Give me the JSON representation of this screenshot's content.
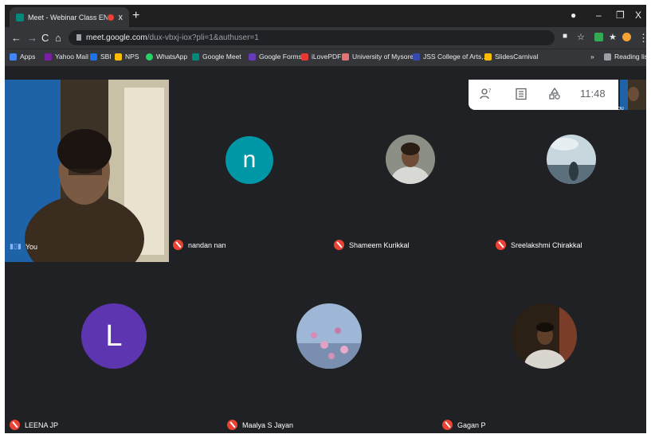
{
  "browser": {
    "tab_title": "Meet - Webinar Class END (",
    "tab_close": "x",
    "new_tab": "+",
    "url_domain": "meet.google.com",
    "url_rest": "/dux-vbxj-iox?pli=1&authuser=1",
    "window_controls": {
      "minimize": "–",
      "restore": "❐",
      "close": "X"
    }
  },
  "bookmarks": [
    {
      "label": "Apps",
      "color": "#4285f4"
    },
    {
      "label": "Yahoo Mail",
      "color": "#7b1fa2"
    },
    {
      "label": "SBI",
      "color": "#1a73e8"
    },
    {
      "label": "NPS",
      "color": "#fbbc04"
    },
    {
      "label": "WhatsApp",
      "color": "#25d366"
    },
    {
      "label": "Google Meet",
      "color": "#00897b"
    },
    {
      "label": "Google Forms",
      "color": "#673ab7"
    },
    {
      "label": "iLovePDF",
      "color": "#e53935"
    },
    {
      "label": "University of Mysore",
      "color": "#e57373"
    },
    {
      "label": "JSS College of Arts,...",
      "color": "#3949ab"
    },
    {
      "label": "SlidesCarnival",
      "color": "#fbbc04"
    }
  ],
  "reading_list": "Reading list",
  "meet": {
    "clock": "11:48",
    "self_label": "You",
    "participants": [
      {
        "name": "nandan nan",
        "initial": "n",
        "avatar_color": "#0097a7"
      },
      {
        "name": "Shameem Kurikkal",
        "photo": true
      },
      {
        "name": "Sreelakshmi Chirakkal",
        "photo": true
      },
      {
        "name": "LEENA JP",
        "initial": "L",
        "avatar_color": "#5e35b1"
      },
      {
        "name": "Maalya S Jayan",
        "photo": true
      },
      {
        "name": "Gagan P",
        "photo": true
      }
    ]
  },
  "icons": {
    "people": "people-icon",
    "chat": "chat-icon",
    "activities": "activities-icon"
  }
}
